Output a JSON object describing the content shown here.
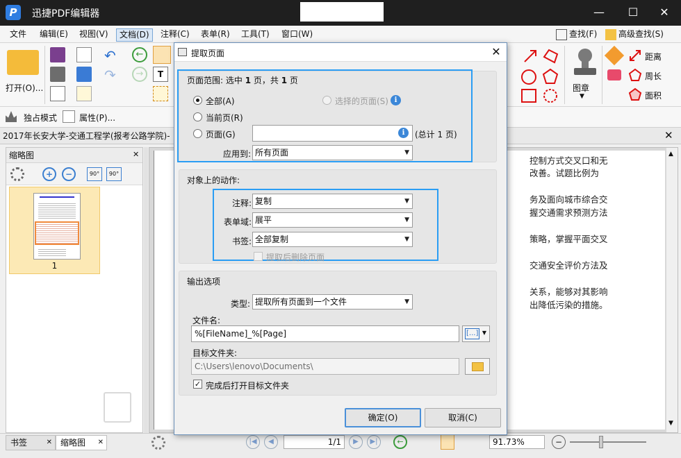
{
  "app": {
    "title": "迅捷PDF编辑器",
    "logo_letter": "P"
  },
  "window_controls": {
    "minimize": "—",
    "maximize": "☐",
    "close": "✕"
  },
  "menubar": {
    "items": [
      "文件",
      "编辑(E)",
      "视图(V)",
      "文档(D)",
      "注释(C)",
      "表单(R)",
      "工具(T)",
      "窗口(W)"
    ],
    "active_index": 3,
    "find": "查找(F)",
    "advanced_find": "高级查找(S)"
  },
  "ribbon": {
    "open_label": "打开(O)...",
    "exclusive_mode": "独占模式",
    "properties": "属性(P)...",
    "stamp": "图章",
    "distance": "距离",
    "perimeter": "周长",
    "area": "面积"
  },
  "document_tab": {
    "title": "2017年长安大学-交通工程学(报考公路学院)-"
  },
  "thumbnail_panel": {
    "title": "缩略图",
    "page_number": "1"
  },
  "document_text": [
    "控制方式交叉口和无",
    "改善。试题比例为",
    "",
    "务及面向城市综合交",
    "握交通需求预测方法",
    "",
    "策略，掌握平面交叉",
    "",
    "交通安全评价方法及",
    "",
    "关系，能够对其影响",
    "出降低污染的措施。"
  ],
  "bottom": {
    "tab_bookmarks": "书签",
    "tab_thumbnails": "缩略图",
    "page_indicator": "1/1",
    "zoom": "91.73%"
  },
  "dialog": {
    "title": "提取页面",
    "close": "✕",
    "page_range": {
      "title_prefix": "页面范围: 选中 ",
      "selected": "1",
      "title_mid": " 页，共 ",
      "total": "1",
      "title_suffix": " 页",
      "all_label": "全部(A)",
      "selected_pages_label": "选择的页面(S)",
      "current_label": "当前页(R)",
      "pages_label": "页面(G)",
      "pages_value": "",
      "total_info": "(总计 1 页)",
      "apply_to_label": "应用到:",
      "apply_to_value": "所有页面",
      "selected_option": "all"
    },
    "actions": {
      "title": "对象上的动作:",
      "annotations_label": "注释:",
      "annotations_value": "复制",
      "form_fields_label": "表单域:",
      "form_fields_value": "展平",
      "bookmarks_label": "书签:",
      "bookmarks_value": "全部复制",
      "delete_after_label": "提取后删除页面",
      "delete_after_checked": false
    },
    "output": {
      "title": "输出选项",
      "type_label": "类型:",
      "type_value": "提取所有页面到一个文件",
      "filename_label": "文件名:",
      "filename_value": "%[FileName]_%[Page]",
      "macro_button": "[...]",
      "folder_label": "目标文件夹:",
      "folder_value": "C:\\Users\\lenovo\\Documents\\",
      "open_after_label": "完成后打开目标文件夹",
      "open_after_checked": true
    },
    "ok": "确定(O)",
    "cancel": "取消(C)"
  },
  "colors": {
    "highlight": "#2a9df4",
    "accent_red": "#d11111",
    "title_bar": "#1f1f1f"
  }
}
